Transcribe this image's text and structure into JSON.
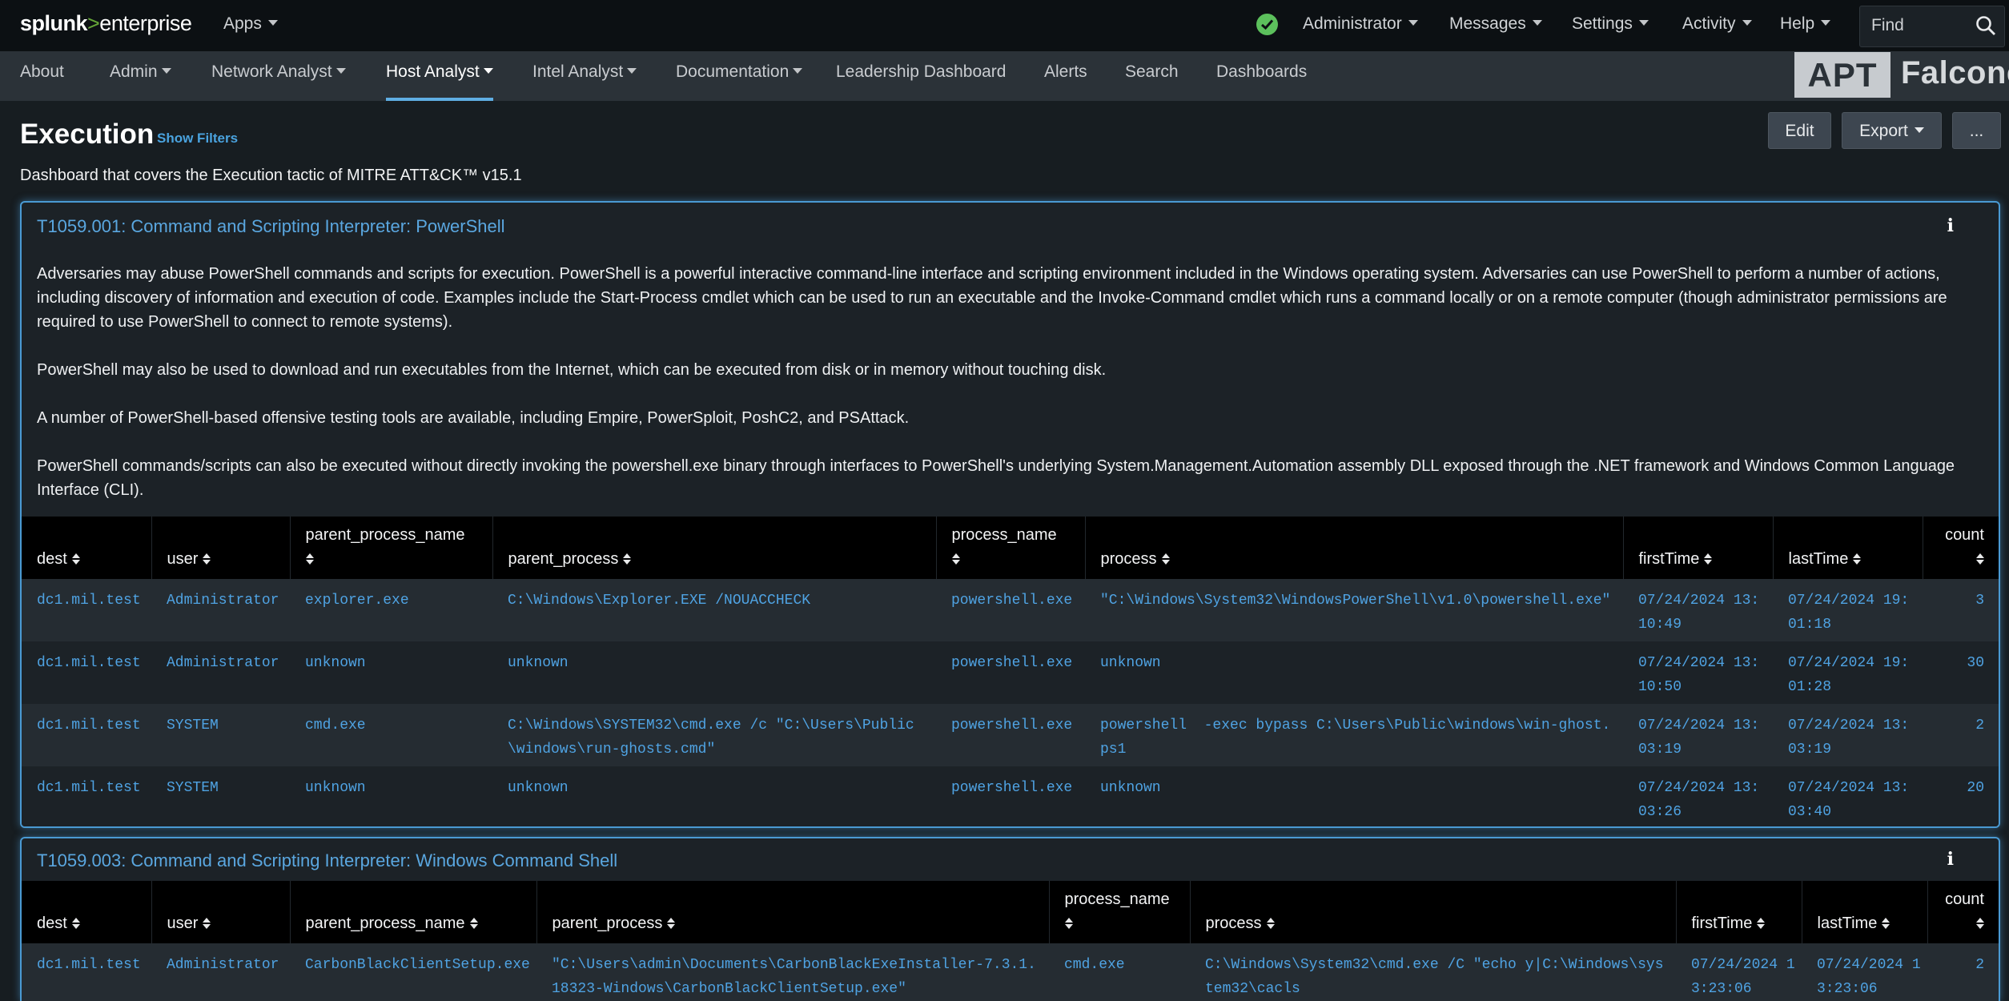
{
  "topbar": {
    "logo_bold": "splunk",
    "logo_gt": ">",
    "logo_rest": "enterprise",
    "apps_label": "Apps",
    "status_icon": "check-circle-icon",
    "status_color": "#5cc05c",
    "menus": [
      "Administrator",
      "Messages",
      "Settings",
      "Activity",
      "Help"
    ],
    "find_placeholder": "Find"
  },
  "nav": {
    "items": [
      "About",
      "Admin",
      "Network Analyst",
      "Host Analyst",
      "Intel Analyst",
      "Documentation",
      "Leadership Dashboard",
      "Alerts",
      "Search",
      "Dashboards"
    ],
    "active": "Host Analyst",
    "brand_apt": "APT",
    "brand_name": "Falconer"
  },
  "page": {
    "title": "Execution",
    "show_filters": "Show Filters",
    "description": "Dashboard that covers the Execution tactic of MITRE ATT&CK™ v15.1",
    "edit_label": "Edit",
    "export_label": "Export",
    "more_label": "..."
  },
  "colors": {
    "accent": "#4fa3e3",
    "panel_border": "#4a9ad3",
    "background": "#171d21"
  },
  "panel1": {
    "title": "T1059.001: Command and Scripting Interpreter: PowerShell",
    "info_icon": "i",
    "paragraphs": [
      "Adversaries may abuse PowerShell commands and scripts for execution. PowerShell is a powerful interactive command-line interface and scripting environment included in the Windows operating system. Adversaries can use PowerShell to perform a number of actions, including discovery of information and execution of code. Examples include the Start-Process cmdlet which can be used to run an executable and the Invoke-Command cmdlet which runs a command locally or on a remote computer (though administrator permissions are required to use PowerShell to connect to remote systems).",
      "PowerShell may also be used to download and run executables from the Internet, which can be executed from disk or in memory without touching disk.",
      "A number of PowerShell-based offensive testing tools are available, including Empire, PowerSploit, PoshC2, and PSAttack.",
      "PowerShell commands/scripts can also be executed without directly invoking the powershell.exe binary through interfaces to PowerShell's underlying System.Management.Automation assembly DLL exposed through the .NET framework and Windows Common Language Interface (CLI)."
    ],
    "columns": [
      "dest",
      "user",
      "parent_process_name",
      "parent_process",
      "process_name",
      "process",
      "firstTime",
      "lastTime",
      "count"
    ],
    "rows": [
      [
        "dc1.mil.test",
        "Administrator",
        "explorer.exe",
        "C:\\Windows\\Explorer.EXE /NOUACCHECK",
        "powershell.exe",
        "\"C:\\Windows\\System32\\WindowsPowerShell\\v1.0\\powershell.exe\"",
        "07/24/2024 13:10:49",
        "07/24/2024 19:01:18",
        "3"
      ],
      [
        "dc1.mil.test",
        "Administrator",
        "unknown",
        "unknown",
        "powershell.exe",
        "unknown",
        "07/24/2024 13:10:50",
        "07/24/2024 19:01:28",
        "30"
      ],
      [
        "dc1.mil.test",
        "SYSTEM",
        "cmd.exe",
        "C:\\Windows\\SYSTEM32\\cmd.exe /c \"C:\\Users\\Public\\windows\\run-ghosts.cmd\"",
        "powershell.exe",
        "powershell  -exec bypass C:\\Users\\Public\\windows\\win-ghost.ps1",
        "07/24/2024 13:03:19",
        "07/24/2024 13:03:19",
        "2"
      ],
      [
        "dc1.mil.test",
        "SYSTEM",
        "unknown",
        "unknown",
        "powershell.exe",
        "unknown",
        "07/24/2024 13:03:26",
        "07/24/2024 13:03:40",
        "20"
      ]
    ]
  },
  "panel2": {
    "title": "T1059.003: Command and Scripting Interpreter: Windows Command Shell",
    "info_icon": "i",
    "columns": [
      "dest",
      "user",
      "parent_process_name",
      "parent_process",
      "process_name",
      "process",
      "firstTime",
      "lastTime",
      "count"
    ],
    "rows": [
      [
        "dc1.mil.test",
        "Administrator",
        "CarbonBlackClientSetup.exe",
        "\"C:\\Users\\admin\\Documents\\CarbonBlackExeInstaller-7.3.1.18323-Windows\\CarbonBlackClientSetup.exe\"",
        "cmd.exe",
        "C:\\Windows\\System32\\cmd.exe /C \"echo y|C:\\Windows\\system32\\cacls",
        "07/24/2024 13:23:06",
        "07/24/2024 13:23:06",
        "2"
      ]
    ]
  }
}
